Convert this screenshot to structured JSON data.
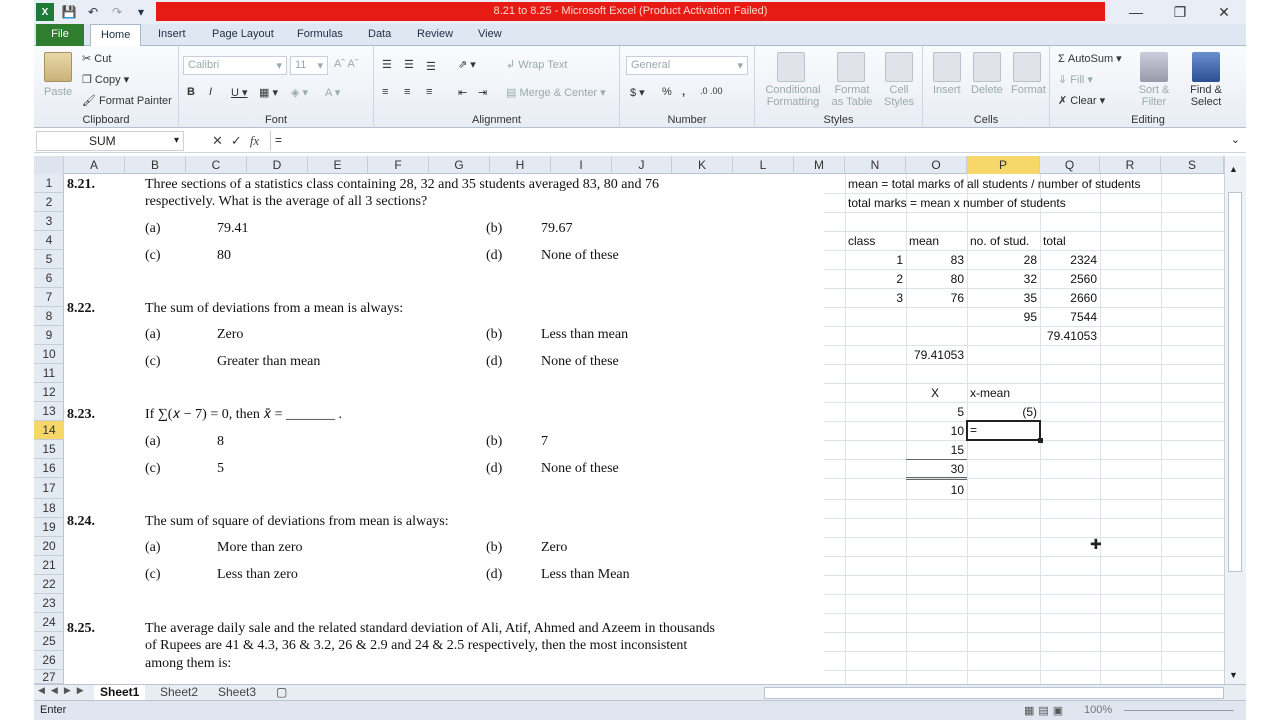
{
  "title": "8.21 to 8.25  -  Microsoft Excel (Product Activation Failed)",
  "tabs": [
    "File",
    "Home",
    "Insert",
    "Page Layout",
    "Formulas",
    "Data",
    "Review",
    "View"
  ],
  "ribbon": {
    "clipboard": {
      "paste": "Paste",
      "cut": "Cut",
      "copy": "Copy",
      "format_painter": "Format Painter",
      "label": "Clipboard"
    },
    "font": {
      "name": "Calibri",
      "size": "11",
      "label": "Font"
    },
    "alignment": {
      "wrap": "Wrap Text",
      "merge": "Merge & Center",
      "label": "Alignment"
    },
    "number": {
      "format": "General",
      "label": "Number"
    },
    "styles": {
      "conditional": "Conditional",
      "conditional2": "Formatting",
      "format_table": "Format",
      "format_table2": "as Table",
      "cell": "Cell",
      "cell2": "Styles",
      "label": "Styles"
    },
    "cells": {
      "insert": "Insert",
      "delete": "Delete",
      "format": "Format",
      "label": "Cells"
    },
    "editing": {
      "autosum": "AutoSum",
      "fill": "Fill",
      "clear": "Clear",
      "sort": "Sort &",
      "sort2": "Filter",
      "find": "Find &",
      "find2": "Select",
      "label": "Editing"
    }
  },
  "formula_bar": {
    "name_box": "SUM",
    "fx": "fx",
    "content": "="
  },
  "columns": [
    "A",
    "B",
    "C",
    "D",
    "E",
    "F",
    "G",
    "H",
    "I",
    "J",
    "K",
    "L",
    "M",
    "N",
    "O",
    "P",
    "Q",
    "R",
    "S"
  ],
  "rows": [
    "1",
    "2",
    "3",
    "4",
    "5",
    "6",
    "7",
    "8",
    "9",
    "10",
    "11",
    "12",
    "13",
    "14",
    "15",
    "16",
    "17",
    "18",
    "19",
    "20",
    "21",
    "22",
    "23",
    "24",
    "25",
    "26",
    "27"
  ],
  "questions": {
    "q21": {
      "num": "8.21.",
      "text1": "Three sections of a statistics class containing 28, 32 and 35 students averaged 83, 80 and 76",
      "text2": "respectively. What is the average of all 3 sections?",
      "a": "(a)",
      "a_v": "79.41",
      "b": "(b)",
      "b_v": "79.67",
      "c": "(c)",
      "c_v": "80",
      "d": "(d)",
      "d_v": "None of these"
    },
    "q22": {
      "num": "8.22.",
      "text": "The sum of deviations from a mean is always:",
      "a": "(a)",
      "a_v": "Zero",
      "b": "(b)",
      "b_v": "Less than mean",
      "c": "(c)",
      "c_v": "Greater than mean",
      "d": "(d)",
      "d_v": "None of these"
    },
    "q23": {
      "num": "8.23.",
      "text": "If ∑(𝑥 − 7) = 0, then 𝑥̄ = _______ .",
      "a": "(a)",
      "a_v": "8",
      "b": "(b)",
      "b_v": "7",
      "c": "(c)",
      "c_v": "5",
      "d": "(d)",
      "d_v": "None of these"
    },
    "q24": {
      "num": "8.24.",
      "text": "The sum of square of deviations from mean is always:",
      "a": "(a)",
      "a_v": "More than zero",
      "b": "(b)",
      "b_v": "Zero",
      "c": "(c)",
      "c_v": "Less than zero",
      "d": "(d)",
      "d_v": "Less than Mean"
    },
    "q25": {
      "num": "8.25.",
      "text1": "The average daily sale and the related standard deviation of Ali, Atif, Ahmed and Azeem in thousands",
      "text2": "of Rupees are 41 & 4.3, 36 & 3.2, 26 & 2.9 and 24 & 2.5 respectively, then the most inconsistent",
      "text3": "among them is:"
    }
  },
  "work": {
    "n1": "mean = total marks of all students / number of students",
    "n2": "total marks = mean x number of students",
    "h_class": "class",
    "h_mean": "mean",
    "h_nos": "no. of stud.",
    "h_total": "total",
    "r5": [
      "1",
      "83",
      "28",
      "2324"
    ],
    "r6": [
      "2",
      "80",
      "32",
      "2560"
    ],
    "r7": [
      "3",
      "76",
      "35",
      "2660"
    ],
    "r8_p": "95",
    "r8_q": "7544",
    "r9_q": "79.41053",
    "r10_o": "79.41053",
    "h_x": "X",
    "h_xm": "x-mean",
    "r13_o": "5",
    "r13_p": "(5)",
    "r14_o": "10",
    "r14_p": "=",
    "r15_o": "15",
    "r16_o": "30",
    "r17_o": "10"
  },
  "sheets": [
    "Sheet1",
    "Sheet2",
    "Sheet3"
  ],
  "status": {
    "mode": "Enter",
    "zoom": "100%"
  }
}
